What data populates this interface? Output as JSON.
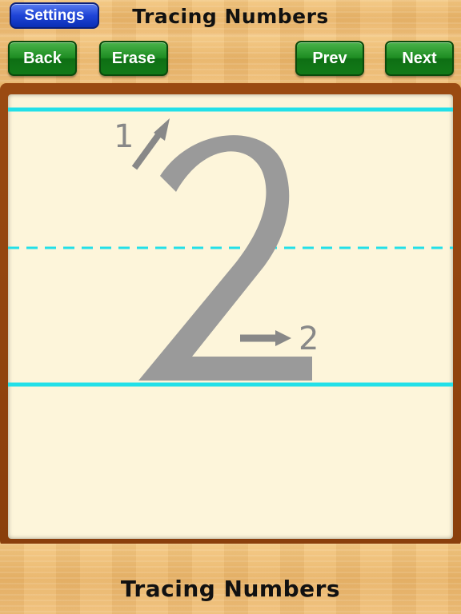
{
  "header": {
    "title": "Tracing Numbers",
    "settings_label": "Settings"
  },
  "toolbar": {
    "back_label": "Back",
    "erase_label": "Erase",
    "prev_label": "Prev",
    "next_label": "Next"
  },
  "tracing": {
    "digit": "2",
    "stroke_numbers": [
      "1",
      "2"
    ],
    "guide_color": "#22e0e8",
    "glyph_color": "#9a9a9a"
  },
  "footer": {
    "title": "Tracing Numbers"
  },
  "colors": {
    "settings_button": "#1f44d6",
    "action_buttons": "#1e8d22",
    "board_frame": "#8a3f0c",
    "board_paper": "#fdf5da"
  }
}
